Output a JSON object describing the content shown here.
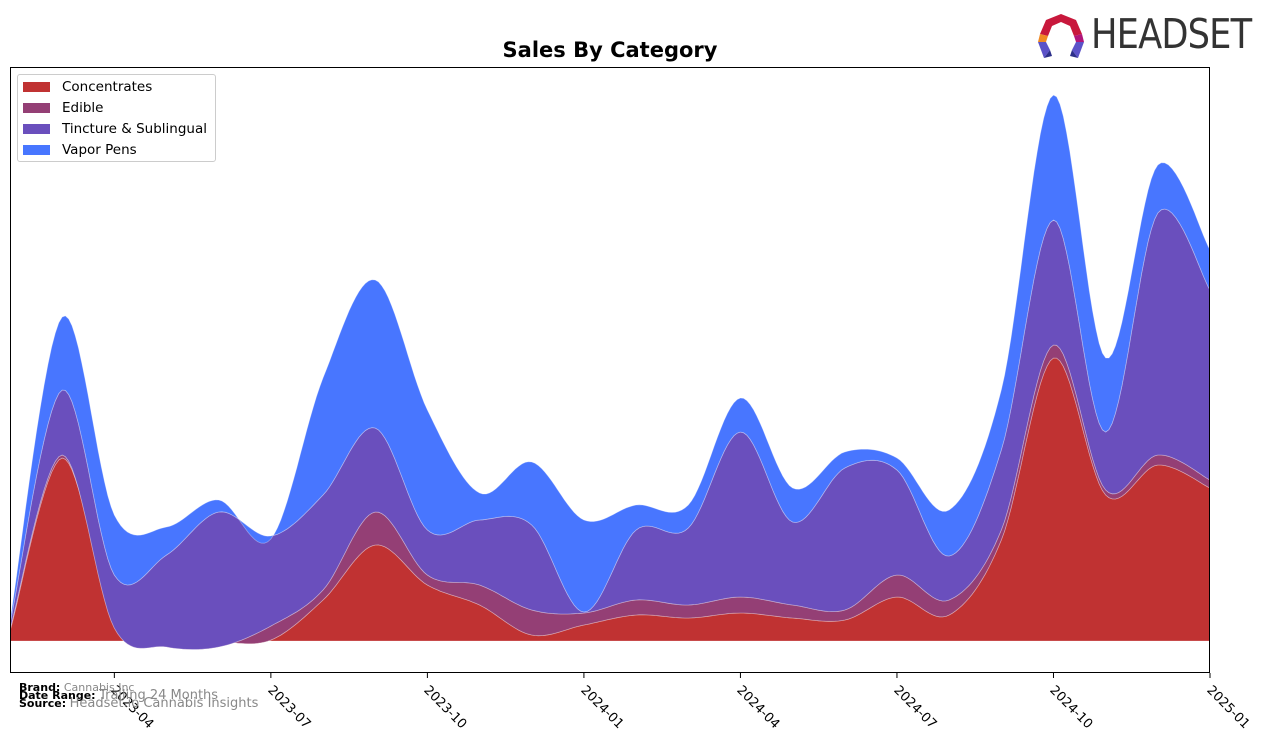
{
  "header": {
    "logo_text": "HEADSET"
  },
  "chart_data": {
    "type": "area",
    "stacked": true,
    "smoothed": true,
    "title": "Sales By Category",
    "xlabel": "",
    "ylabel": "",
    "y_axis_visible": false,
    "grid": false,
    "legend_position": "top-left",
    "x": [
      "2023-02",
      "2023-03",
      "2023-04",
      "2023-05",
      "2023-06",
      "2023-07",
      "2023-08",
      "2023-09",
      "2023-10",
      "2023-11",
      "2023-12",
      "2024-01",
      "2024-02",
      "2024-03",
      "2024-04",
      "2024-05",
      "2024-06",
      "2024-07",
      "2024-08",
      "2024-09",
      "2024-10",
      "2024-11",
      "2024-12",
      "2025-01"
    ],
    "x_ticks": [
      "2023-04",
      "2023-07",
      "2023-10",
      "2024-01",
      "2024-04",
      "2024-07",
      "2024-10",
      "2025-01"
    ],
    "series": [
      {
        "name": "Concentrates",
        "color": "#c03232",
        "values": [
          10,
          183,
          21,
          1,
          -1,
          1,
          41,
          96,
          56,
          36,
          6,
          16,
          26,
          23,
          28,
          23,
          21,
          44,
          26,
          101,
          283,
          146,
          176,
          153
        ]
      },
      {
        "name": "Edible",
        "color": "#943f75",
        "values": [
          2,
          3,
          -8,
          -7,
          -5,
          14,
          10,
          33,
          10,
          20,
          25,
          12,
          15,
          13,
          16,
          13,
          10,
          22,
          15,
          10,
          13,
          5,
          10,
          8
        ]
      },
      {
        "name": "Tincture & Sublingual",
        "color": "#6a4fbd",
        "values": [
          5,
          65,
          53,
          92,
          135,
          90,
          95,
          84,
          45,
          65,
          85,
          1,
          70,
          77,
          165,
          83,
          142,
          105,
          44,
          80,
          125,
          58,
          242,
          190
        ]
      },
      {
        "name": "Vapor Pens",
        "color": "#4876ff",
        "values": [
          3,
          73,
          60,
          28,
          12,
          -3,
          117,
          148,
          120,
          27,
          63,
          92,
          25,
          23,
          34,
          34,
          16,
          12,
          46,
          60,
          125,
          74,
          48,
          40
        ]
      }
    ]
  },
  "footer": {
    "brand_label": "Brand:",
    "brand_value": "Cannabis Inc",
    "date_range_label": "Date Range:",
    "date_range_value": "Trailing 24 Months",
    "source_label": "Source:",
    "source_value": "Headset.io Cannabis Insights"
  }
}
